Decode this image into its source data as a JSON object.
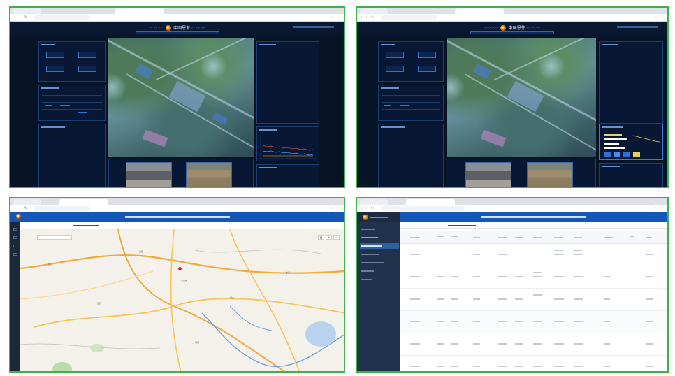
{
  "dashboard": {
    "brand": "中国恩菲",
    "wave_left": "〰〰〰",
    "wave_right": "〰〰〰"
  },
  "map_app": {
    "map_labels": [
      "大连市",
      "沈阳",
      "鞍山",
      "辽阳",
      "营口",
      "本溪",
      "海城"
    ]
  },
  "colors": {
    "frame_border": "#3cb34a",
    "dashboard_bg": "#071426",
    "app_header": "#1457b8",
    "map_pin": "#e02424"
  }
}
